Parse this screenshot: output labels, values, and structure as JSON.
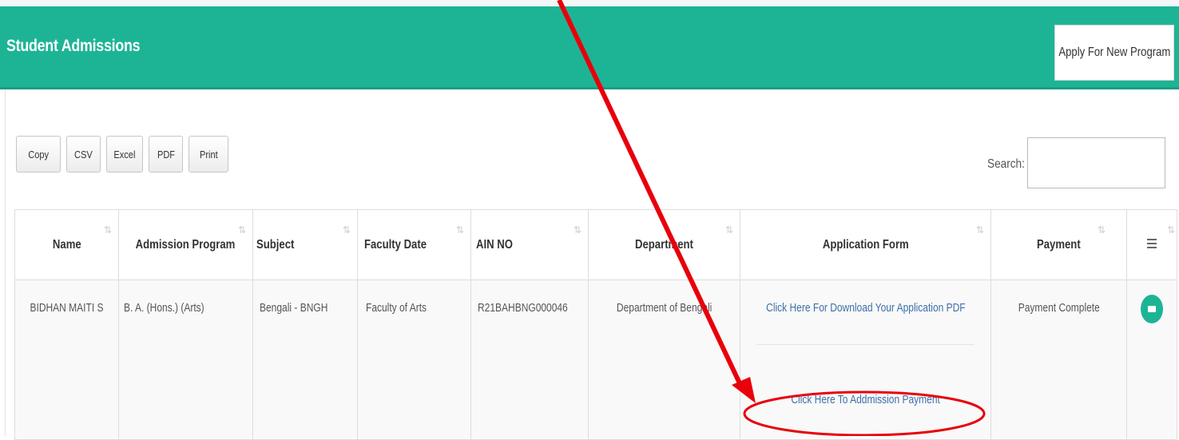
{
  "header": {
    "title": "Student Admissions",
    "apply_button": "Apply For New Program"
  },
  "export_buttons": [
    "Copy",
    "CSV",
    "Excel",
    "PDF",
    "Print"
  ],
  "search": {
    "label": "Search:",
    "value": ""
  },
  "table": {
    "columns": [
      "Name",
      "Admission Program",
      "Subject",
      "Faculty Date",
      "AIN NO",
      "Department",
      "Application Form",
      "Payment"
    ],
    "row": {
      "name": "BIDHAN MAITI S",
      "program": "B. A. (Hons.) (Arts)",
      "subject": "Bengali - BNGH",
      "faculty": "Faculty of Arts",
      "ain": "R21BAHBNG000046",
      "department": "Department of Bengali",
      "download_link": "Click Here For Download Your Application PDF",
      "payment_link": "Click Here To Addmission Payment",
      "payment_status": "Payment Complete"
    }
  },
  "colors": {
    "accent": "#1db496",
    "link": "#3d6fa8",
    "annotation": "#e8000b"
  },
  "icons": {
    "sort": "sort-icon",
    "column_visibility": "menu-icon",
    "action": "circle-action-icon"
  }
}
